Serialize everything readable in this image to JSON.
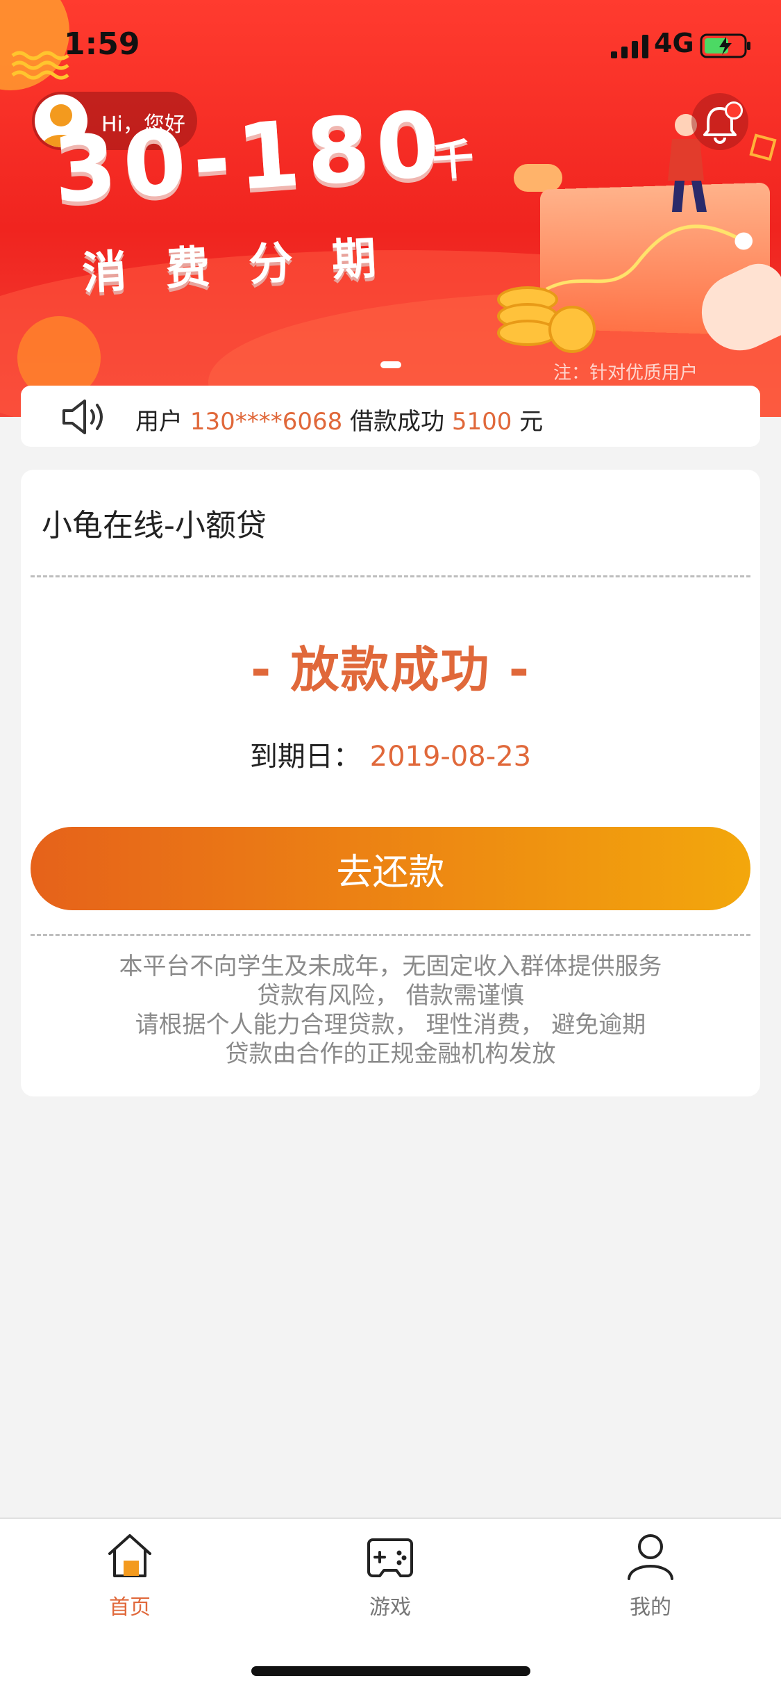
{
  "status_bar": {
    "time": "1:59",
    "network": "4G"
  },
  "banner": {
    "greeting": "Hi，您好",
    "headline_amount": "30-180",
    "headline_unit": "千",
    "subline": "消费分期",
    "note": "注：针对优质用户"
  },
  "notice": {
    "prefix": "用户",
    "phone": "130****6068",
    "middle": "借款成功",
    "amount": "5100",
    "suffix": "元"
  },
  "card": {
    "title": "小龟在线-小额贷",
    "status": "- 放款成功 -",
    "due_label": "到期日：",
    "due_date": "2019-08-23",
    "repay_button": "去还款",
    "disclaimer": [
      "本平台不向学生及未成年，无固定收入群体提供服务",
      "贷款有风险，  借款需谨慎",
      "请根据个人能力合理贷款，  理性消费，  避免逾期",
      "贷款由合作的正规金融机构发放"
    ]
  },
  "tabbar": {
    "tabs": [
      {
        "label": "首页",
        "icon": "home-icon",
        "active": true
      },
      {
        "label": "游戏",
        "icon": "gamepad-icon",
        "active": false
      },
      {
        "label": "我的",
        "icon": "user-icon",
        "active": false
      }
    ]
  },
  "colors": {
    "accent": "#e0683a",
    "banner_red": "#f0241f",
    "button_start": "#e6621a",
    "button_end": "#f3a70c"
  }
}
